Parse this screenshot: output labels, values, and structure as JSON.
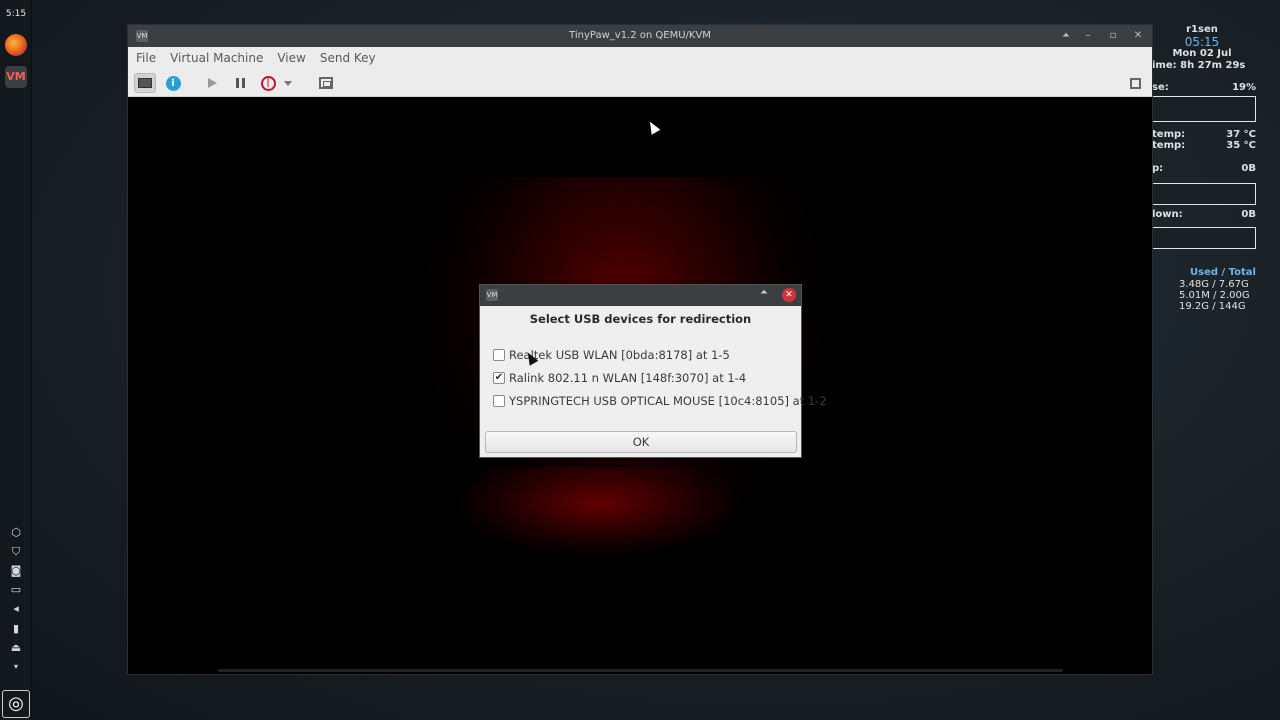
{
  "dock": {
    "clock": "5:15",
    "icons": [
      "firefox-icon",
      "virt-manager-icon"
    ],
    "tray_icons": [
      "network-icon",
      "shield-icon",
      "camera-icon",
      "display-icon",
      "volume-icon",
      "battery-icon",
      "eject-icon"
    ],
    "menu_glyph": "◎"
  },
  "conky": {
    "user": "r1sen",
    "time": "05:15",
    "date": "Mon 02 Jul",
    "uptime": "ime: 8h 27m 29s",
    "cpu_label": "se:",
    "cpu_value": "19%",
    "temp1_label": "temp:",
    "temp1_value": "37 °C",
    "temp2_label": "temp:",
    "temp2_value": "35 °C",
    "up_label": "p:",
    "up_value": "0B",
    "down_label": "lown:",
    "down_value": "0B",
    "mem_header": "Used / Total",
    "mem_rows": [
      "3.48G  / 7.67G",
      "5.01M  / 2.00G",
      "19.2G  / 144G"
    ]
  },
  "window": {
    "title": "TinyPaw_v1.2 on QEMU/KVM",
    "menu": [
      "File",
      "Virtual Machine",
      "View",
      "Send Key"
    ],
    "controls": {
      "up": "⏶",
      "minimize": "–",
      "restore": "▫",
      "close": "✕"
    }
  },
  "toolbar": {
    "buttons": [
      "console-button",
      "details-button",
      "run-button",
      "pause-button",
      "shutdown-button",
      "shutdown-menu-button",
      "snapshots-button",
      "fullscreen-button"
    ]
  },
  "dialog": {
    "title": "Select USB devices for redirection",
    "devices": [
      {
        "label": "Realtek USB WLAN [0bda:8178] at 1-5",
        "checked": false
      },
      {
        "label": "Ralink 802.11 n WLAN [148f:3070] at 1-4",
        "checked": true
      },
      {
        "label": "YSPRINGTECH USB OPTICAL MOUSE [10c4:8105] at 1-2",
        "checked": false
      }
    ],
    "ok_label": "OK"
  }
}
